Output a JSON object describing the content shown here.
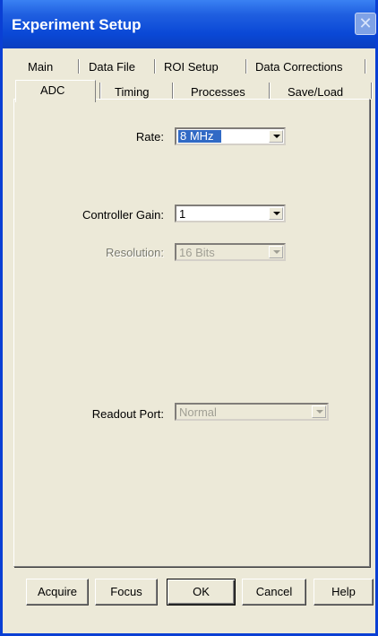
{
  "window": {
    "title": "Experiment Setup",
    "close_label": "✕"
  },
  "tabs_row1": [
    "Main",
    "Data File",
    "ROI Setup",
    "Data Corrections"
  ],
  "tabs_row2": [
    "ADC",
    "Timing",
    "Processes",
    "Save/Load"
  ],
  "active_tab": "ADC",
  "fields": {
    "rate": {
      "label": "Rate:",
      "value": "8 MHz"
    },
    "controller_gain": {
      "label": "Controller Gain:",
      "value": "1"
    },
    "resolution": {
      "label": "Resolution:",
      "value": "16 Bits"
    },
    "readout_port": {
      "label": "Readout Port:",
      "value": "Normal"
    }
  },
  "buttons": {
    "acquire": "Acquire",
    "focus": "Focus",
    "ok": "OK",
    "cancel": "Cancel",
    "help": "Help"
  }
}
